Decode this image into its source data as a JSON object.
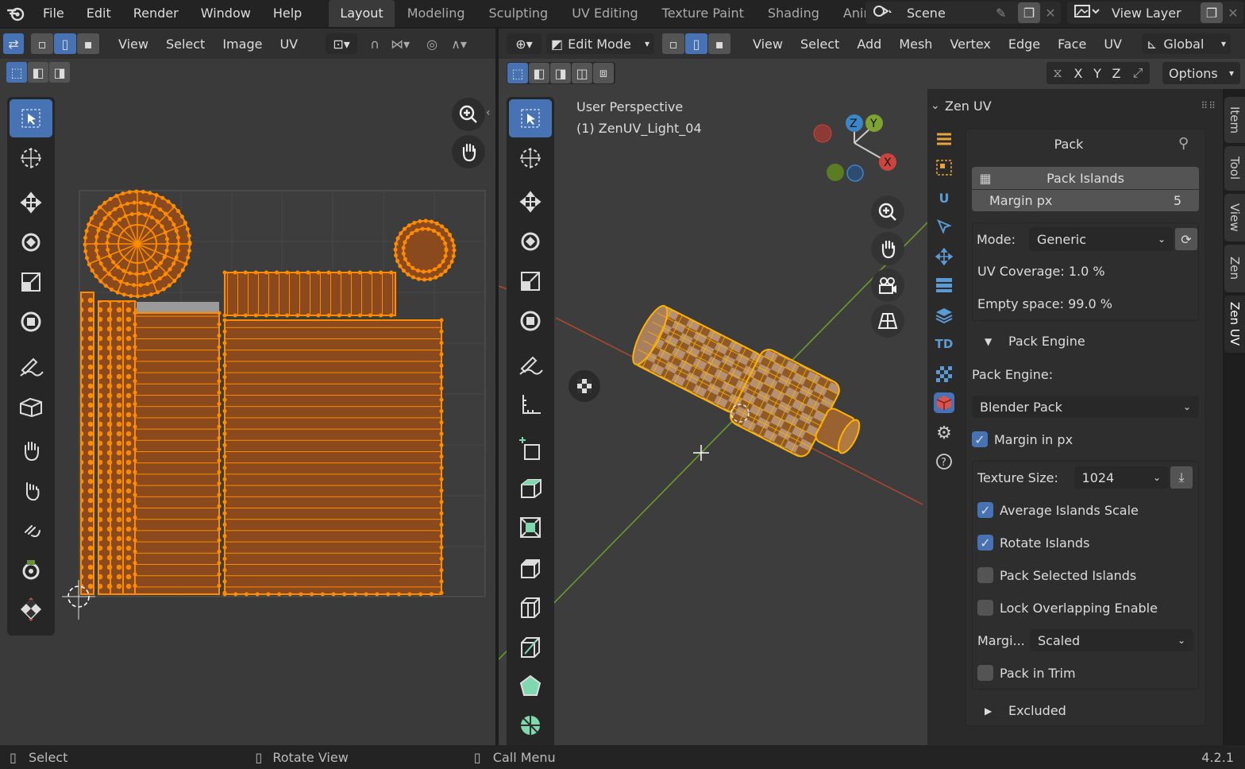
{
  "topbar": {
    "menus": [
      "File",
      "Edit",
      "Render",
      "Window",
      "Help"
    ],
    "workspaces": [
      "Layout",
      "Modeling",
      "Sculpting",
      "UV Editing",
      "Texture Paint",
      "Shading",
      "Animati"
    ],
    "active_workspace": "Layout",
    "scene_name": "Scene",
    "view_layer": "View Layer"
  },
  "uv_editor": {
    "menus": [
      "View",
      "Select",
      "Image",
      "UV"
    ]
  },
  "viewport": {
    "mode": "Edit Mode",
    "menus": [
      "View",
      "Select",
      "Add",
      "Mesh",
      "Vertex",
      "Edge",
      "Face",
      "UV"
    ],
    "orientation": "Global",
    "options_label": "Options",
    "axes": [
      "X",
      "Y",
      "Z"
    ],
    "overlay_title": "User Perspective",
    "overlay_object": "(1) ZenUV_Light_04",
    "gizmo": {
      "x": "X",
      "y": "Y",
      "z": "Z",
      "x_color": "#c9453e",
      "y_color": "#7ea331",
      "z_color": "#3a86c8"
    }
  },
  "zen": {
    "header": "Zen UV",
    "panel_title": "Pack",
    "pack_button": "Pack Islands",
    "margin_label": "Margin px",
    "margin_value": "5",
    "mode_label": "Mode:",
    "mode_value": "Generic",
    "uv_coverage": "UV Coverage: 1.0 %",
    "empty_space": "Empty space: 99.0 %",
    "pack_engine_section": "Pack Engine",
    "pack_engine_label": "Pack Engine:",
    "pack_engine_value": "Blender Pack",
    "margin_in_px": "Margin in px",
    "texture_size_label": "Texture Size:",
    "texture_size_value": "1024",
    "avg_scale": "Average Islands Scale",
    "rotate": "Rotate Islands",
    "pack_selected": "Pack Selected Islands",
    "lock_overlap": "Lock Overlapping Enable",
    "margin_method_label": "Margi...",
    "margin_method_value": "Scaled",
    "pack_in_trim": "Pack in Trim",
    "excluded": "Excluded"
  },
  "tabs": [
    "Item",
    "Tool",
    "View",
    "Zen",
    "Zen UV"
  ],
  "status": {
    "select": "Select",
    "rotate": "Rotate View",
    "call_menu": "Call Menu",
    "version": "4.2.1"
  },
  "colors": {
    "accent": "#4772b3",
    "uv_orange": "#ff8c00",
    "island_fill": "#8b4a1d"
  }
}
